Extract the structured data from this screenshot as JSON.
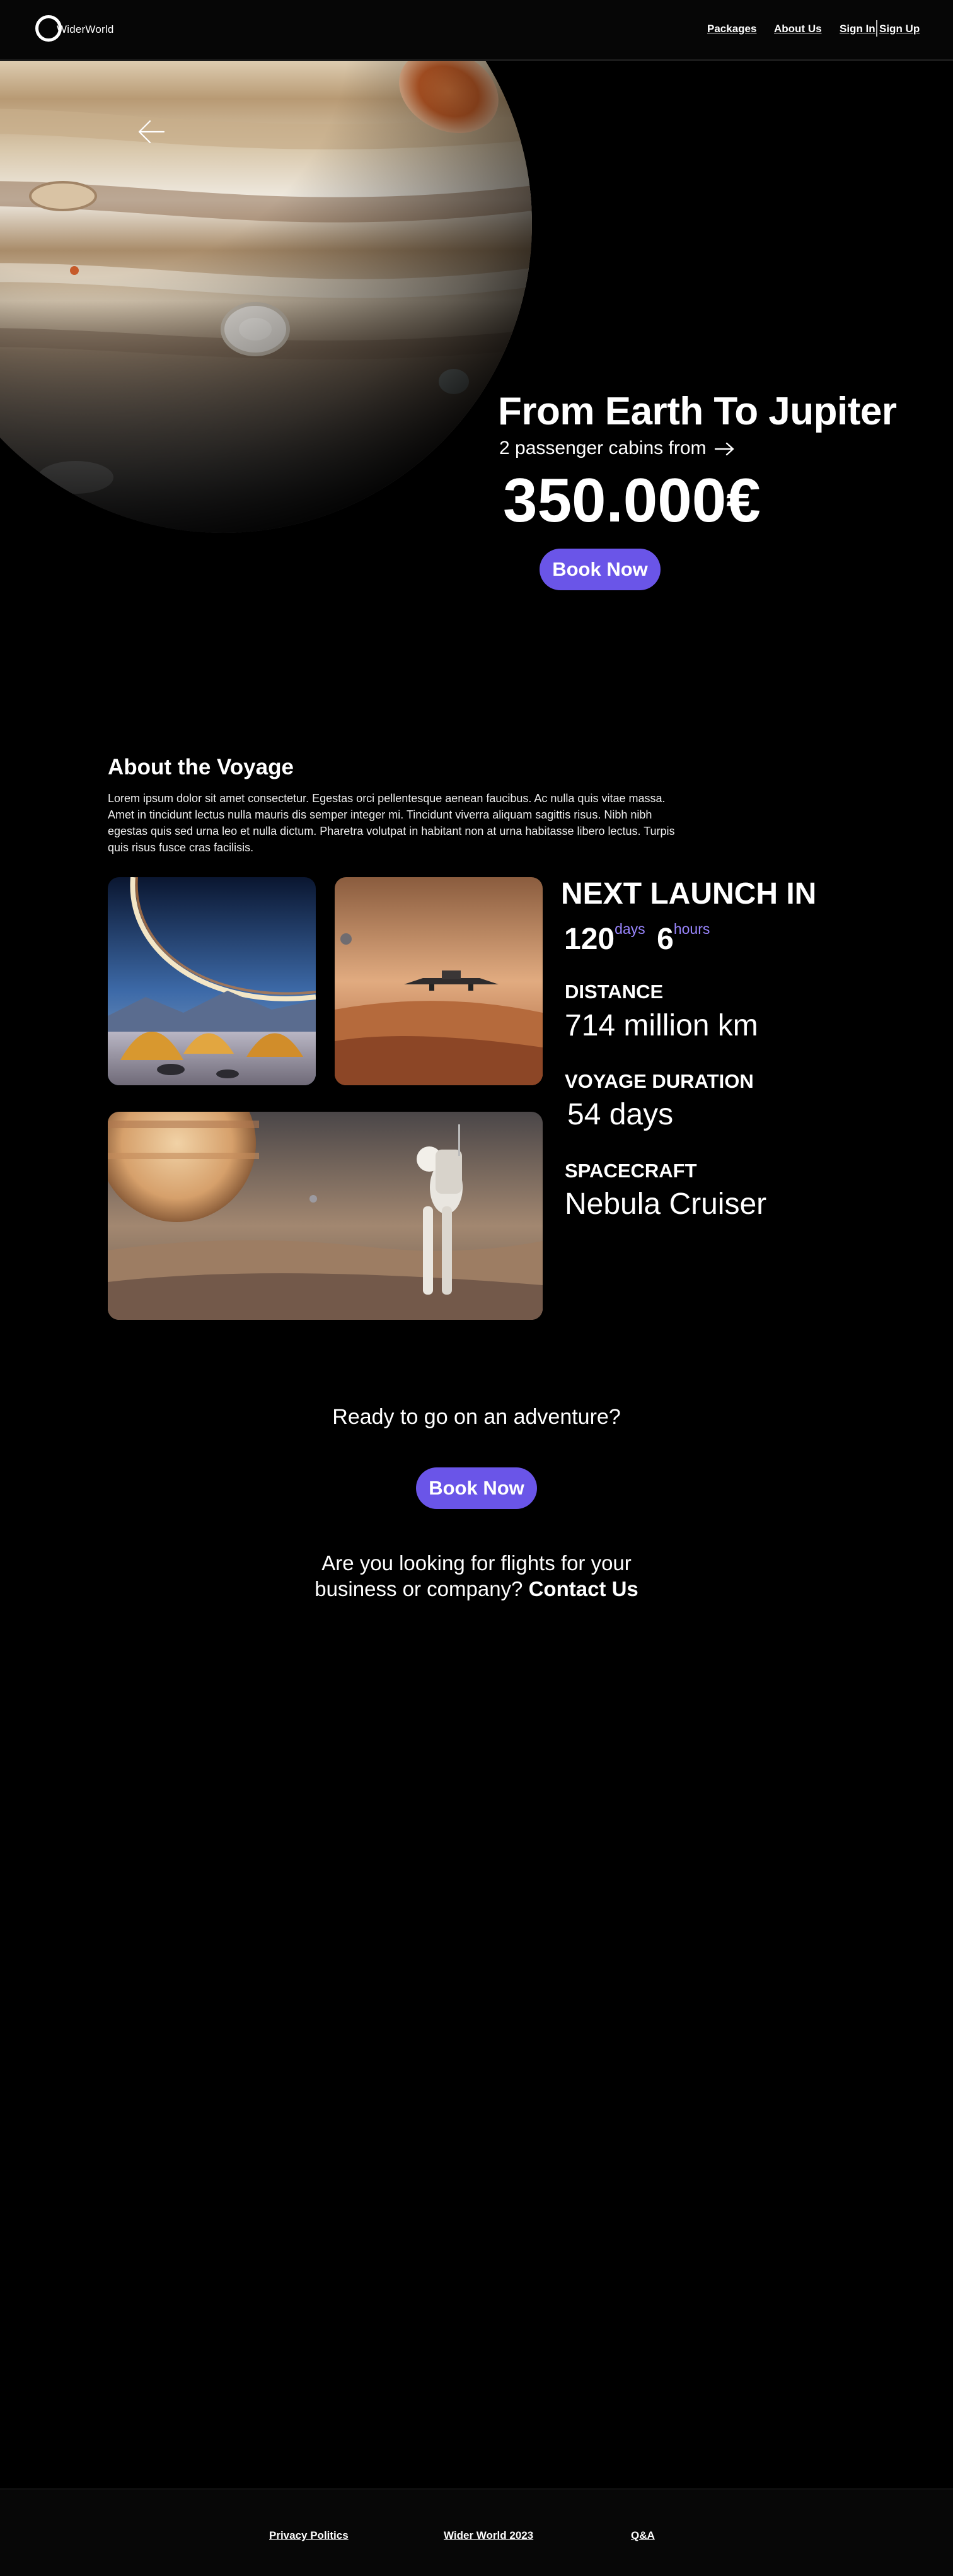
{
  "header": {
    "logo_text": "WiderWorld",
    "nav": {
      "packages": "Packages",
      "about": "About Us",
      "sign_in": "Sign In",
      "sign_up": "Sign Up"
    }
  },
  "hero": {
    "title": "From Earth To Jupiter",
    "subtitle": "2 passenger cabins from",
    "price": "350.000€",
    "cta": "Book Now",
    "back_icon": "arrow-left-icon",
    "subtitle_icon": "arrow-right-icon"
  },
  "about": {
    "title": "About the Voyage",
    "text": "Lorem ipsum dolor sit amet consectetur. Egestas orci pellentesque aenean faucibus. Ac nulla quis vitae massa. Amet in tincidunt lectus nulla mauris dis semper integer mi. Tincidunt viverra aliquam sagittis risus. Nibh nibh egestas quis sed urna leo et nulla dictum. Pharetra volutpat in habitant non at urna habitasse libero lectus. Turpis quis risus fusce cras facilisis."
  },
  "launch": {
    "title": "NEXT LAUNCH IN",
    "days_value": "120",
    "days_unit": "days",
    "hours_value": "6",
    "hours_unit": "hours",
    "accent_color": "#9a86ff"
  },
  "stats": {
    "distance_label": "DISTANCE",
    "distance_value": "714 million km",
    "duration_label": "VOYAGE DURATION",
    "duration_value": "54 days",
    "spacecraft_label": "SPACECRAFT",
    "spacecraft_value": "Nebula Cruiser"
  },
  "cta": {
    "question": "Ready to go on an adventure?",
    "button": "Book Now",
    "business_line1": "Are you looking for flights for your",
    "business_line2": "business or company?",
    "contact_link": "Contact Us"
  },
  "footer": {
    "privacy": "Privacy Politics",
    "copyright": "Wider World 2023",
    "qa": "Q&A"
  },
  "colors": {
    "background": "#000000",
    "button": "#6a55e8",
    "text": "#ffffff"
  }
}
